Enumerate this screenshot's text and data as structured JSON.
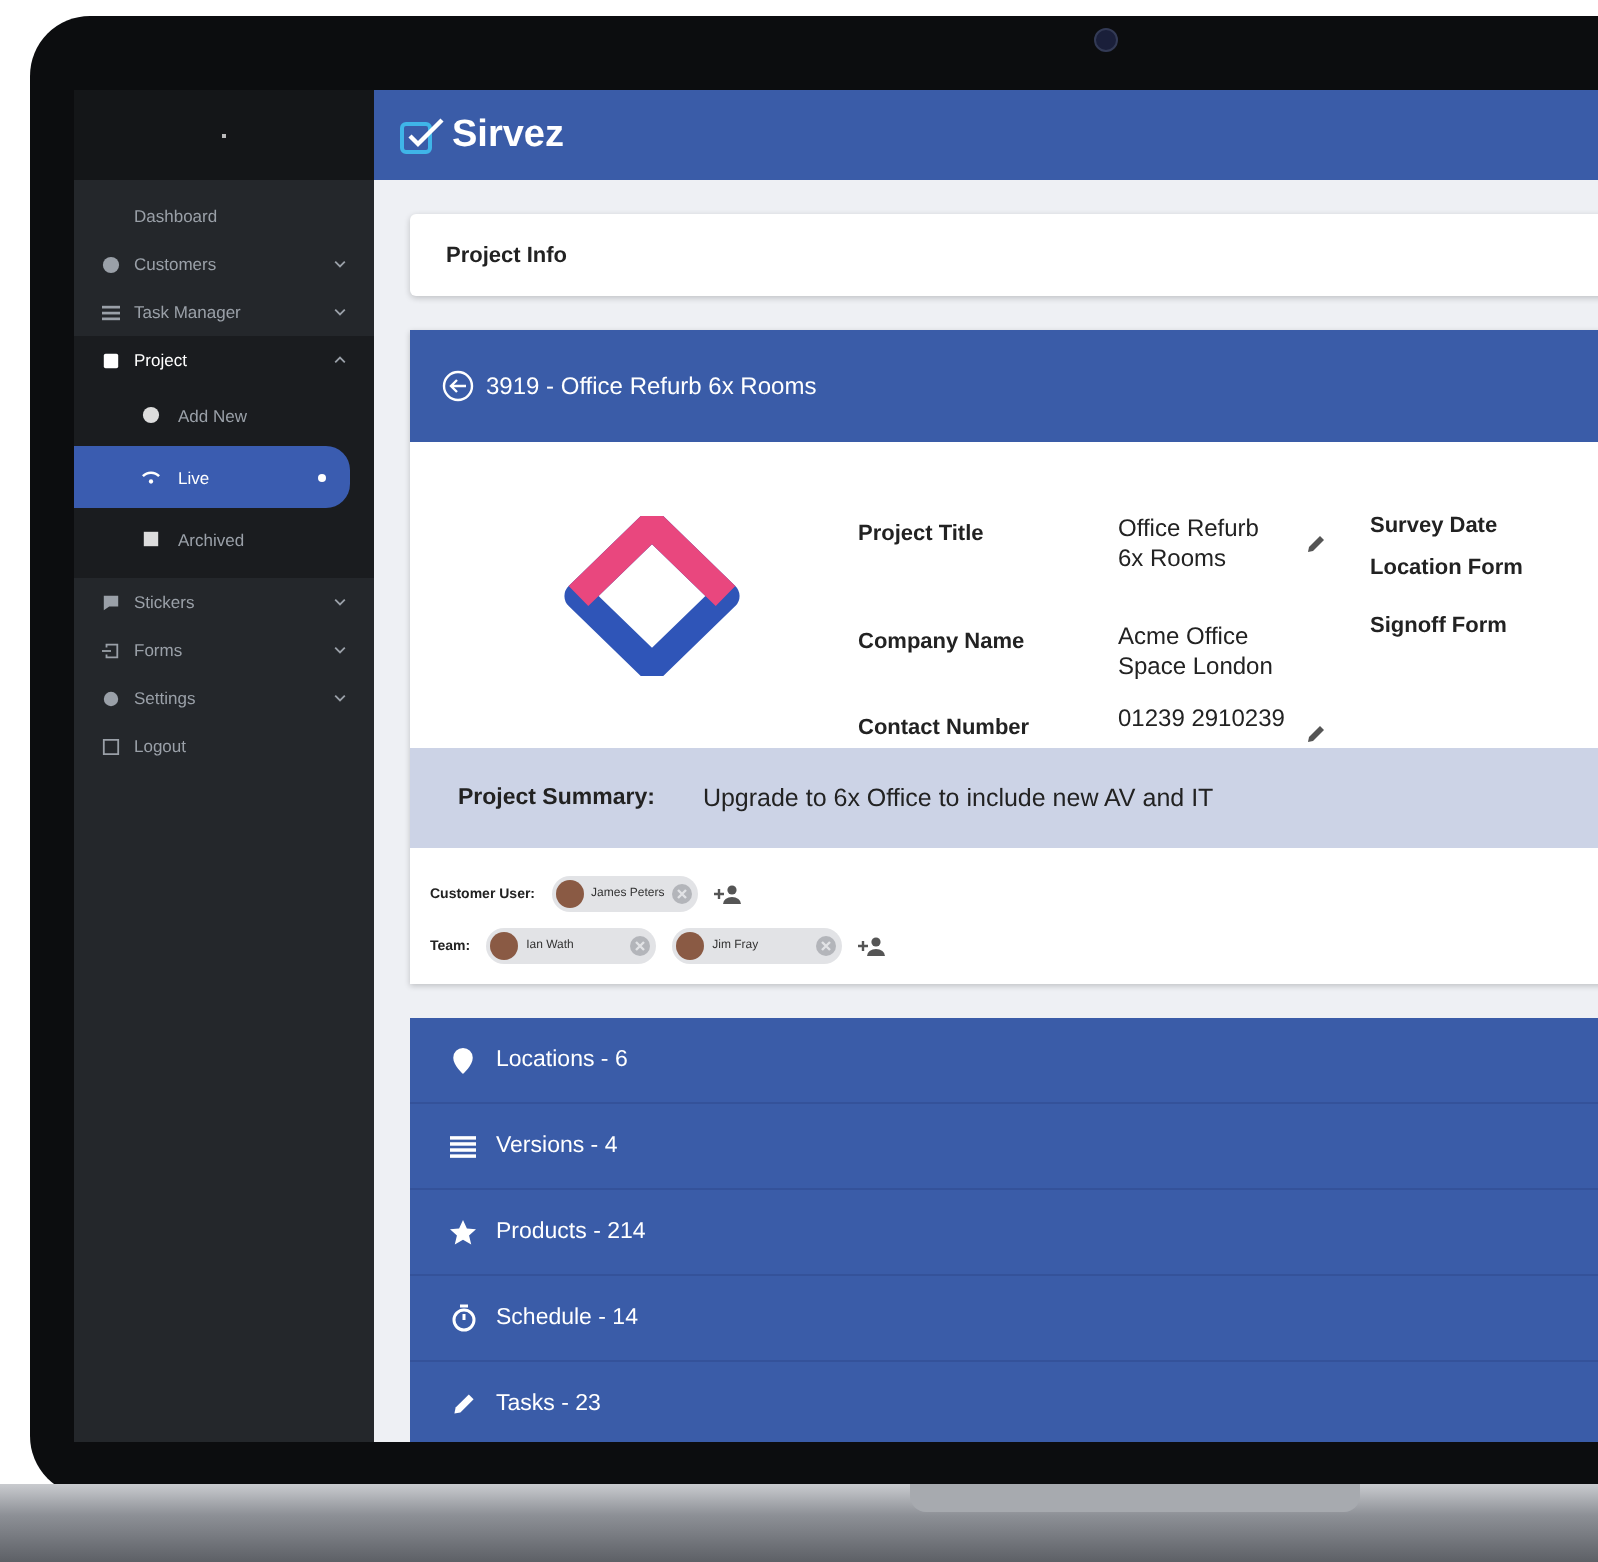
{
  "header": {
    "app_name": "Sirvez"
  },
  "sidebar": {
    "items": [
      {
        "label": "Dashboard",
        "selected": false
      },
      {
        "label": "Customers",
        "selected": false,
        "expanded": false
      },
      {
        "label": "Task Manager",
        "selected": false,
        "expanded": false
      },
      {
        "label": "Project",
        "selected": false,
        "expanded": true,
        "children": [
          {
            "label": "Add New",
            "selected": false
          },
          {
            "label": "Live",
            "selected": true
          },
          {
            "label": "Archived",
            "selected": false
          }
        ]
      },
      {
        "label": "Stickers",
        "selected": false,
        "expanded": false
      },
      {
        "label": "Forms",
        "selected": false,
        "expanded": false
      },
      {
        "label": "Settings",
        "selected": false,
        "expanded": false
      },
      {
        "label": "Logout",
        "selected": false
      }
    ]
  },
  "page_title": "Project Info",
  "project": {
    "heading": "3919 - Office Refurb 6x Rooms",
    "fields": [
      {
        "label": "Project Title",
        "value": "Office Refurb\n6x Rooms",
        "editable": true
      },
      {
        "label": "Company Name",
        "value": "Acme Office\nSpace London",
        "editable": false
      },
      {
        "label": "Contact Number",
        "value": "01239 2910239",
        "editable": true
      }
    ],
    "side_fields": [
      "Survey Date",
      "Location Form",
      "Signoff Form"
    ],
    "summary": {
      "label": "Project Summary:",
      "value": "Upgrade to 6x Office to include new AV and IT"
    }
  },
  "people": [
    {
      "label": "Customer User:",
      "chips": [
        {
          "name": "James Peters"
        }
      ]
    },
    {
      "label": "Team:",
      "chips": [
        {
          "name": "Ian Wath"
        },
        {
          "name": "Jim Fray"
        }
      ]
    }
  ],
  "sections": [
    {
      "label": "Locations - 6"
    },
    {
      "label": "Versions - 4"
    },
    {
      "label": "Products - 214"
    },
    {
      "label": "Schedule - 14"
    },
    {
      "label": "Tasks - 23"
    }
  ]
}
